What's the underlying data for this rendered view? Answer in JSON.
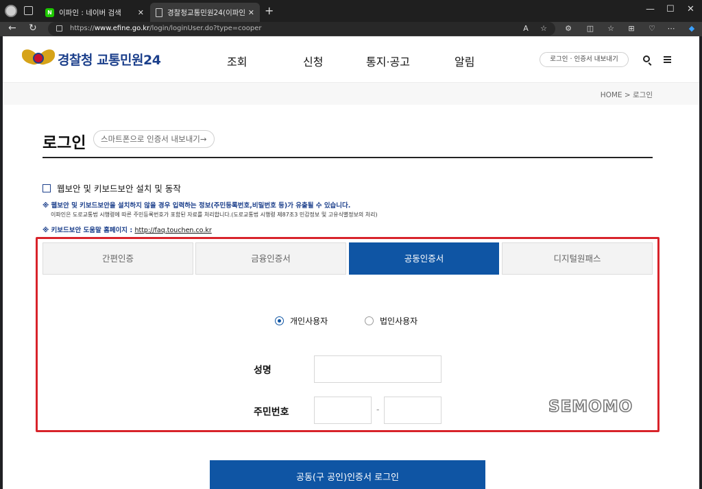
{
  "browser": {
    "tabs": [
      {
        "title": "이파인 : 네이버 검색",
        "favicon": "N"
      },
      {
        "title": "경찰청교통민원24(이파인)"
      }
    ],
    "url_prefix": "https://",
    "url_host": "www.efine.go.kr",
    "url_path": "/login/loginUser.do?type=cooper"
  },
  "header": {
    "logo_a": "경찰청",
    "logo_b": "교통민원24",
    "menu": [
      "조회",
      "신청",
      "통지·공고",
      "알림"
    ],
    "login_export": "로그인 · 인증서 내보내기"
  },
  "breadcrumb": "HOME > 로그인",
  "page": {
    "title": "로그인",
    "export_pill": "스마트폰으로 인증서 내보내기→",
    "security_check_label": "웹보안 및 키보드보안 설치 및 동작",
    "note1": "※ 웹보안 및 키보드보안을 설치하지 않을 경우 입력하는 정보(주민등록번호,비밀번호 등)가 유출될 수 있습니다.",
    "note2": "이파인은 도로교통법 시행령에 따른 주민등록번호가 포함된 자료를 처리합니다.(도로교통법 시행령 제87조3 민감정보 및 고유식별정보의 처리)",
    "note3_prefix": "※ 키보드보안 도움말 홈페이지 : ",
    "note3_link": "http://faq.touchen.co.kr"
  },
  "auth_tabs": [
    {
      "label": "간편인증",
      "active": false
    },
    {
      "label": "금융인증서",
      "active": false
    },
    {
      "label": "공동인증서",
      "active": true
    },
    {
      "label": "디지털원패스",
      "active": false
    }
  ],
  "user_type": {
    "options": [
      "개인사용자",
      "법인사용자"
    ],
    "selected": "개인사용자"
  },
  "form": {
    "name_label": "성명",
    "name_value": "",
    "rrn_label": "주민번호",
    "rrn_first": "",
    "rrn_second": "",
    "dash": "-"
  },
  "watermark": "SEMOMO",
  "login_button": "공동(구 공인)인증서 로그인",
  "colors": {
    "primary": "#0f55a4",
    "highlight_border": "#d8232a",
    "brand_navy": "#1b3f8b"
  }
}
